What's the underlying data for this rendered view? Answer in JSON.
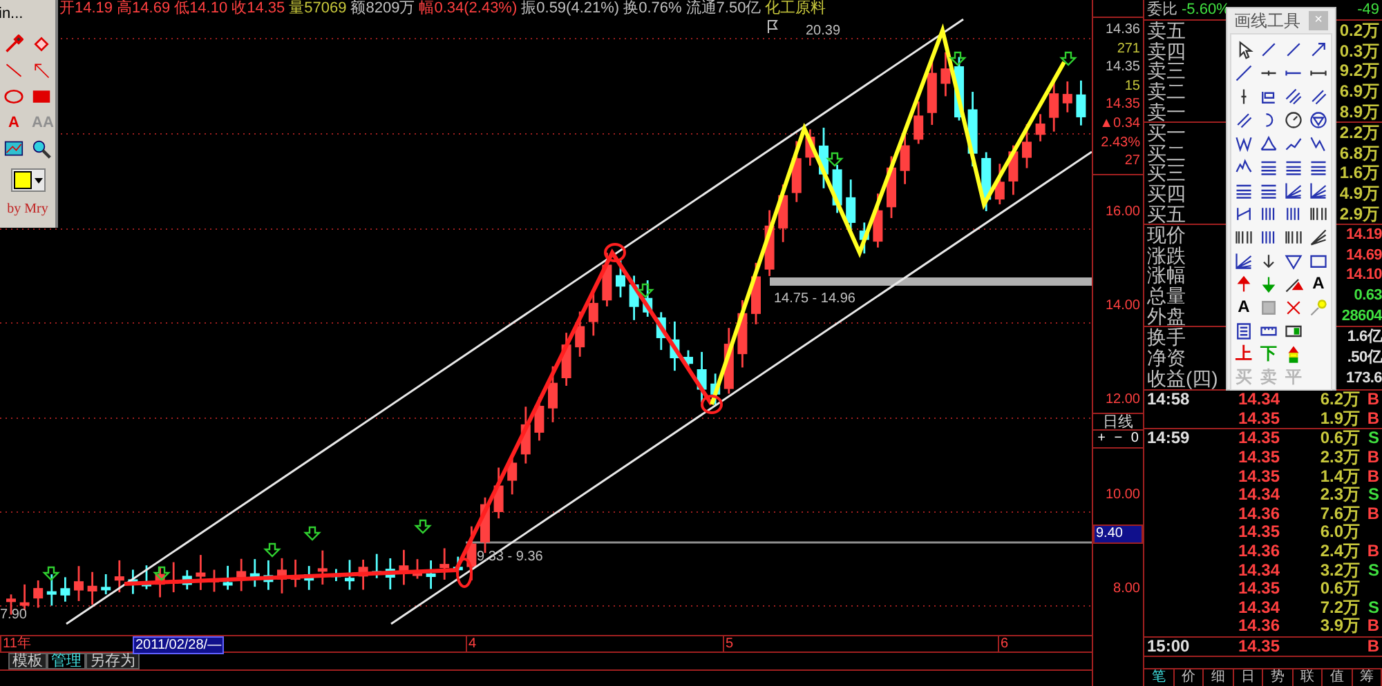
{
  "quote_line": [
    {
      "text": "开14.19",
      "kind": "up"
    },
    {
      "text": "高14.69",
      "kind": "up"
    },
    {
      "text": "低14.10",
      "kind": "up"
    },
    {
      "text": "收14.35",
      "kind": "up"
    },
    {
      "text": "量57069",
      "kind": "volume"
    },
    {
      "text": "额8209万",
      "kind": "neutral"
    },
    {
      "text": "幅0.34(2.43%)",
      "kind": "up"
    },
    {
      "text": "振0.59(4.21%)",
      "kind": "neutral"
    },
    {
      "text": "换0.76%",
      "kind": "neutral"
    },
    {
      "text": "流通7.50亿",
      "kind": "neutral"
    },
    {
      "text": "化工原料",
      "kind": "sector"
    }
  ],
  "mini_toolbar": {
    "title": "in...",
    "text_tools": [
      {
        "label": "A",
        "kind": "bold"
      },
      {
        "label": "AA",
        "kind": "outline"
      }
    ],
    "signature": "by Mry"
  },
  "chart": {
    "labels": [
      {
        "text": "20.39"
      },
      {
        "text": "14.75 - 14.96"
      },
      {
        "text": "9.33 - 9.36"
      },
      {
        "text": "7.90"
      }
    ]
  },
  "time_axis": [
    {
      "text": "11年",
      "selected": false
    },
    {
      "text": "2011/02/28/—",
      "selected": true
    },
    {
      "text": "4",
      "selected": false
    },
    {
      "text": "5",
      "selected": false
    },
    {
      "text": "6",
      "selected": false
    }
  ],
  "bottom_tabs": [
    {
      "label": "模板",
      "selected": false
    },
    {
      "label": "管理",
      "selected": true
    },
    {
      "label": "另存为",
      "selected": false
    }
  ],
  "price_axis": {
    "quote": [
      {
        "text": "14.36",
        "kind": "neutral"
      },
      {
        "text": "271",
        "kind": "volume"
      },
      {
        "text": "14.35",
        "kind": "neutral"
      },
      {
        "text": "15",
        "kind": "volume"
      },
      {
        "text": "14.35",
        "kind": "up"
      },
      {
        "text": "▲0.34",
        "kind": "up"
      },
      {
        "text": "2.43%",
        "kind": "up"
      },
      {
        "text": "27",
        "kind": "up"
      }
    ],
    "ticks": [
      {
        "label": "16.00"
      },
      {
        "label": "14.00"
      },
      {
        "label": "12.00"
      },
      {
        "label": "10.00"
      },
      {
        "label": "8.00"
      }
    ],
    "cursor": "9.40",
    "period": "日线",
    "buttons": [
      "+",
      "−",
      "0"
    ]
  },
  "order_book": {
    "header": [
      {
        "text": "委比",
        "kind": "label"
      },
      {
        "text": "-5.60%",
        "kind": "down"
      },
      {
        "text": "-49",
        "kind": "down"
      }
    ],
    "asks": [
      {
        "label": "卖五",
        "volume": "0.2万"
      },
      {
        "label": "卖四",
        "volume": "0.3万"
      },
      {
        "label": "卖三",
        "volume": "9.2万"
      },
      {
        "label": "卖二",
        "volume": "6.9万"
      },
      {
        "label": "卖一",
        "volume": "8.9万"
      }
    ],
    "bids": [
      {
        "label": "买一",
        "volume": "2.2万"
      },
      {
        "label": "买二",
        "volume": "6.8万"
      },
      {
        "label": "买三",
        "volume": "1.6万"
      },
      {
        "label": "买四",
        "volume": "4.9万"
      },
      {
        "label": "买五",
        "volume": "2.9万"
      }
    ],
    "stats": [
      {
        "label": "现价",
        "value": "14.19",
        "kind": "up"
      },
      {
        "label": "涨跌",
        "value": "14.69",
        "kind": "up"
      },
      {
        "label": "涨幅",
        "value": "14.10",
        "kind": "up"
      },
      {
        "label": "总量",
        "value": "0.63",
        "kind": "down"
      },
      {
        "label": "外盘",
        "value": "28604",
        "kind": "down"
      }
    ],
    "finance": [
      {
        "label": "换手",
        "value": "1.6亿"
      },
      {
        "label": "净资",
        "value": ".50亿"
      },
      {
        "label": "收益(四)",
        "value": "173.6"
      }
    ]
  },
  "trades": [
    {
      "rows": [
        {
          "time": "14:58",
          "price": "14.34",
          "volume": "6.2万",
          "side": "B",
          "kind": "buy"
        },
        {
          "price": "14.35",
          "volume": "1.9万",
          "side": "B",
          "kind": "buy"
        }
      ]
    },
    {
      "rows": [
        {
          "time": "14:59",
          "price": "14.35",
          "volume": "0.6万",
          "side": "S",
          "kind": "sell"
        },
        {
          "price": "14.35",
          "volume": "2.3万",
          "side": "B",
          "kind": "buy"
        },
        {
          "price": "14.35",
          "volume": "1.4万",
          "side": "B",
          "kind": "buy"
        },
        {
          "price": "14.34",
          "volume": "2.3万",
          "side": "S",
          "kind": "sell"
        },
        {
          "price": "14.36",
          "volume": "7.6万",
          "side": "B",
          "kind": "buy"
        },
        {
          "price": "14.35",
          "volume": "6.0万"
        },
        {
          "price": "14.36",
          "volume": "2.4万",
          "side": "B",
          "kind": "buy"
        },
        {
          "price": "14.34",
          "volume": "3.2万",
          "side": "S",
          "kind": "sell"
        },
        {
          "price": "14.35",
          "volume": "0.6万"
        },
        {
          "price": "14.34",
          "volume": "7.2万",
          "side": "S",
          "kind": "sell"
        },
        {
          "price": "14.36",
          "volume": "3.9万",
          "side": "B",
          "kind": "buy"
        }
      ]
    },
    {
      "rows": [
        {
          "time": "15:00",
          "price": "14.35",
          "side": "B",
          "kind": "buy"
        }
      ]
    }
  ],
  "panel_tabs": [
    {
      "label": "笔",
      "selected": true
    },
    {
      "label": "价",
      "selected": false
    },
    {
      "label": "细",
      "selected": false
    },
    {
      "label": "日",
      "selected": false
    },
    {
      "label": "势",
      "selected": false
    },
    {
      "label": "联",
      "selected": false
    },
    {
      "label": "值",
      "selected": false
    },
    {
      "label": "筹",
      "selected": false
    }
  ],
  "palette": {
    "title": "画线工具",
    "close": "×",
    "text_tools": [
      {
        "label": "A",
        "kind": "plain",
        "disabled": false
      },
      {
        "label": "A",
        "kind": "plain",
        "disabled": false
      },
      {
        "label": "上",
        "kind": "up",
        "disabled": false
      },
      {
        "label": "下",
        "kind": "down",
        "disabled": false
      },
      {
        "label": "买",
        "kind": "plain",
        "disabled": true
      },
      {
        "label": "卖",
        "kind": "plain",
        "disabled": true
      },
      {
        "label": "平",
        "kind": "plain",
        "disabled": true
      }
    ]
  }
}
